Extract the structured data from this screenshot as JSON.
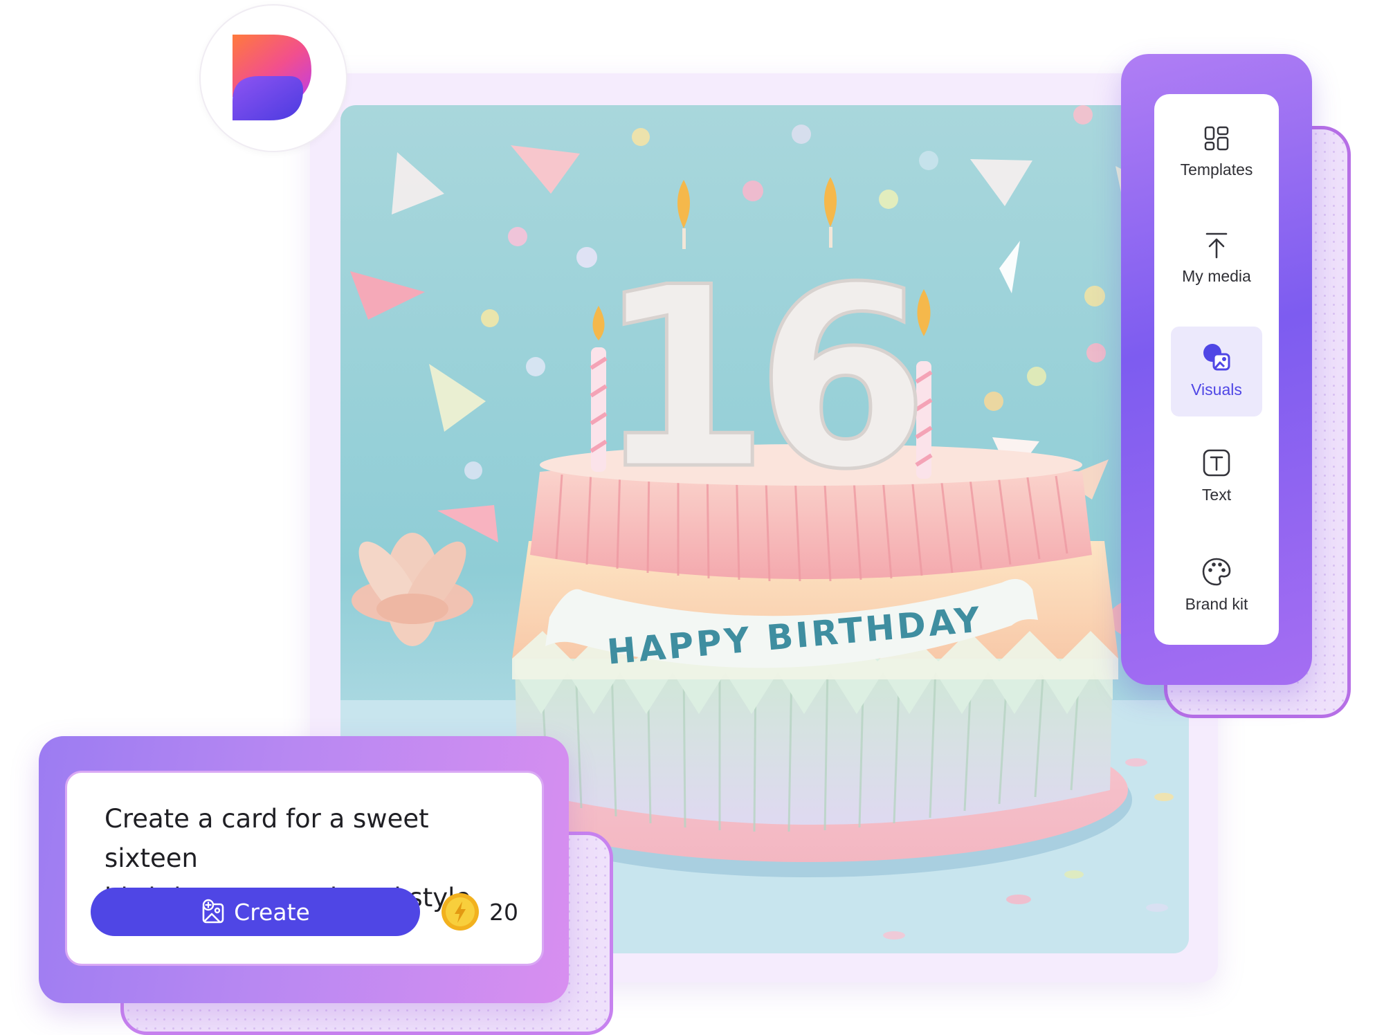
{
  "app": {
    "logo": "designer-logo"
  },
  "canvas": {
    "image": {
      "subject": "origami-birthday-cake",
      "number_text": "16",
      "banner_text": "HAPPY BIRTHDAY"
    }
  },
  "tools": [
    {
      "label": "Templates",
      "icon": "templates-icon",
      "active": false
    },
    {
      "label": "My media",
      "icon": "upload-icon",
      "active": false
    },
    {
      "label": "Visuals",
      "icon": "visuals-icon",
      "active": true
    },
    {
      "label": "Text",
      "icon": "text-icon",
      "active": false
    },
    {
      "label": "Brand kit",
      "icon": "palette-icon",
      "active": false
    }
  ],
  "prompt": {
    "text_line1": "Create a card for a sweet sixteen",
    "text_line2": "birthday party, origami style",
    "create_label": "Create",
    "credits": "20"
  },
  "colors": {
    "accent": "#4f46e5",
    "panel_gradient_start": "#b07ef4",
    "panel_gradient_end": "#7d5cf0",
    "canvas_background": "#a8d8de",
    "coin": "#f5c02a"
  }
}
